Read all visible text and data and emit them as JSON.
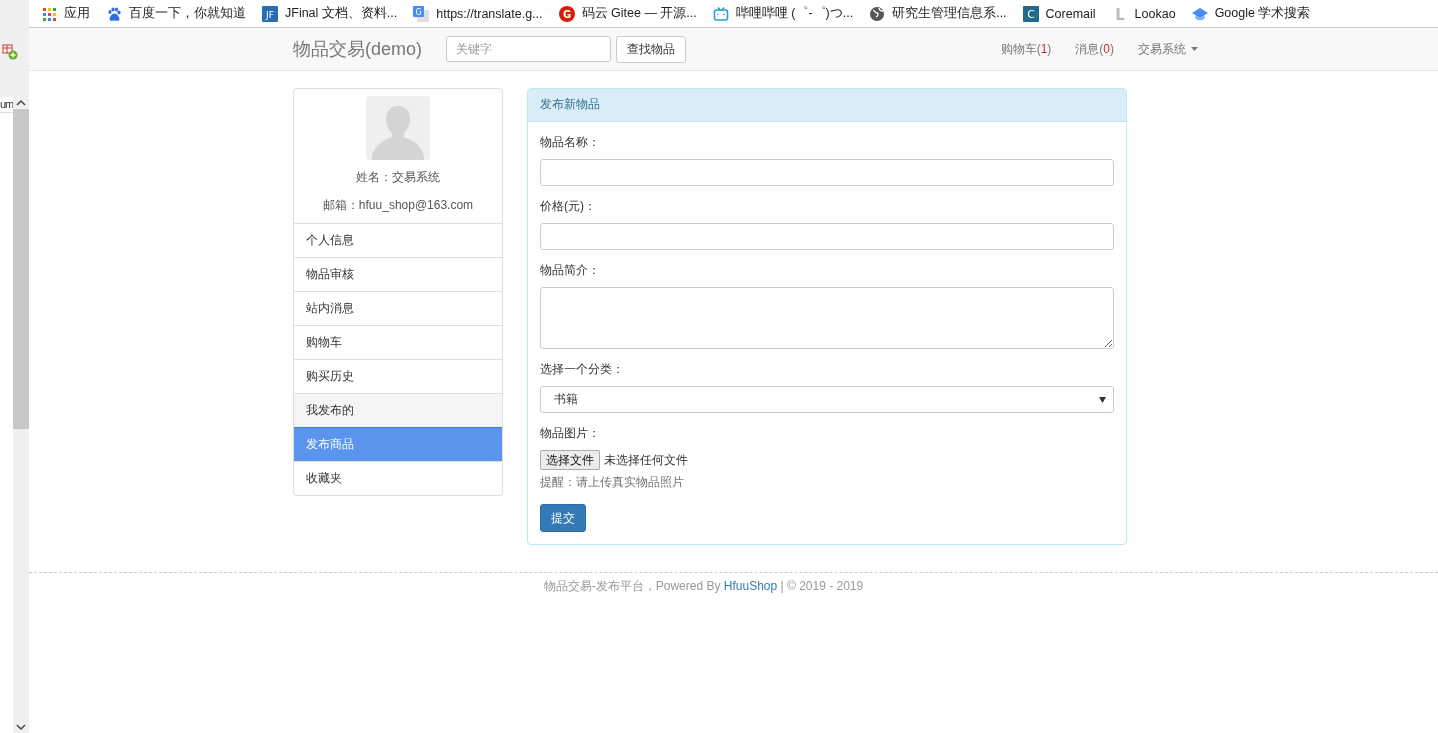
{
  "bookmarks": [
    {
      "kind": "apps",
      "label": "应用"
    },
    {
      "kind": "paw",
      "label": "百度一下，你就知道"
    },
    {
      "kind": "square",
      "badge": "JF",
      "color": "#2a6db5",
      "label": "JFinal 文档、资料..."
    },
    {
      "kind": "translate",
      "badge": "G",
      "label": "https://translate.g..."
    },
    {
      "kind": "circle",
      "badge": "G",
      "color": "#d81e06",
      "label": "码云 Gitee — 开源..."
    },
    {
      "kind": "tv",
      "label": "哔哩哔哩 (゜-゜)つ..."
    },
    {
      "kind": "globe",
      "label": "研究生管理信息系..."
    },
    {
      "kind": "square",
      "badge": "C",
      "color": "#1d6a8c",
      "label": "Coremail"
    },
    {
      "kind": "letter",
      "badge": "L",
      "label": "Lookao"
    },
    {
      "kind": "cap",
      "label": "Google 学术搜索"
    }
  ],
  "side_strip": {
    "column_text": "um"
  },
  "navbar": {
    "brand": "物品交易(demo)",
    "search": {
      "placeholder": "关键字"
    },
    "search_button": "查找物品",
    "links": [
      {
        "label": "购物车(",
        "count": "1",
        "tail": ")"
      },
      {
        "label": "消息(",
        "count": "0",
        "tail": ")"
      }
    ],
    "dropdown": "交易系统"
  },
  "profile": {
    "name": "姓名：交易系统",
    "email": "邮箱：hfuu_shop@163.com"
  },
  "menu": [
    {
      "label": "个人信息",
      "kind": "item",
      "selected": false
    },
    {
      "label": "物品审核",
      "kind": "item",
      "selected": false
    },
    {
      "label": "站内消息",
      "kind": "item",
      "selected": false
    },
    {
      "label": "购物车",
      "kind": "item",
      "selected": false
    },
    {
      "label": "购买历史",
      "kind": "item",
      "selected": false
    },
    {
      "label": "我发布的",
      "kind": "group",
      "selected": false
    },
    {
      "label": "发布商品",
      "kind": "item",
      "selected": true
    },
    {
      "label": "收藏夹",
      "kind": "item",
      "selected": false
    }
  ],
  "form": {
    "title": "发布新物品",
    "fields": [
      {
        "kind": "text",
        "label": "物品名称："
      },
      {
        "kind": "text",
        "label": "价格(元)："
      },
      {
        "kind": "textarea",
        "label": "物品简介："
      },
      {
        "kind": "select",
        "label": "选择一个分类：",
        "value": "书籍"
      },
      {
        "kind": "file",
        "label": "物品图片：",
        "button": "选择文件",
        "status": "未选择任何文件",
        "hint": "提醒：请上传真实物品照片"
      }
    ],
    "submit": "提交"
  },
  "footer": {
    "before": "物品交易-发布平台，Powered By ",
    "link": "HfuuShop",
    "after": " | © 2019 - 2019"
  }
}
